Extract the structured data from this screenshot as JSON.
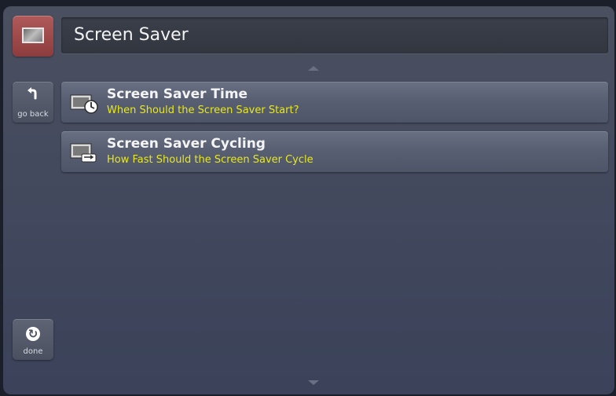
{
  "header": {
    "title": "Screen Saver",
    "icon": "screen-saver-icon",
    "icon_color": "#9a4446"
  },
  "sidebar": {
    "go_back_label": "go back",
    "go_back_icon": "back-arrow-icon",
    "done_label": "done",
    "done_icon": "refresh-circle-icon"
  },
  "menu": {
    "items": [
      {
        "title": "Screen Saver Time",
        "subtitle": "When Should the Screen Saver Start?",
        "icon": "screen-clock-icon"
      },
      {
        "title": "Screen Saver Cycling",
        "subtitle": "How Fast Should the Screen Saver Cycle",
        "icon": "screen-cycle-icon"
      }
    ]
  },
  "colors": {
    "subtitle": "#e8e818",
    "background": "#434a5e"
  }
}
